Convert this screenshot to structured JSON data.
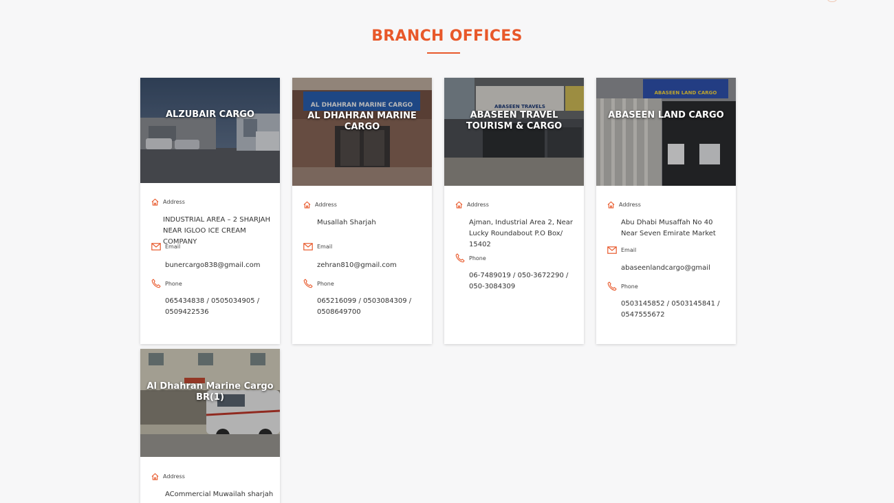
{
  "page": {
    "title": "BRANCH OFFICES",
    "accent": "#e8582a"
  },
  "labels": {
    "address": "Address",
    "email": "Email",
    "phone": "Phone"
  },
  "branches": [
    {
      "name": "ALZUBAIR CARGO",
      "address": "INDUSTRIAL AREA – 2 SHARJAH NEAR IGLOO ICE CREAM COMPANY",
      "email": "bunercargo838@gmail.com",
      "phone": "065434838 / 0505034905 / 0509422536"
    },
    {
      "name": "AL DHAHRAN MARINE CARGO",
      "sign_text": "AL DHAHRAN MARINE CARGO",
      "address": "Musallah Sharjah",
      "email": "zehran810@gmail.com",
      "phone": "065216099 / 0503084309 / 0508649700"
    },
    {
      "name": "ABASEEN TRAVEL TOURISM & CARGO",
      "sign_text": "ABASEEN TRAVELS",
      "address": "Ajman, Industrial Area 2, Near Lucky Roundabout P.O Box/ 15402",
      "phone": "06-7489019 / 050-3672290 / 050-3084309"
    },
    {
      "name": "ABASEEN LAND CARGO",
      "sign_text": "ABASEEN LAND CARGO",
      "address": "Abu Dhabi Musaffah No 40 Near Seven Emirate Market",
      "email": "abaseenlandcargo@gmail",
      "phone": "0503145852 / 0503145841 / 0547555672"
    },
    {
      "name": "Al Dhahran Marine Cargo BR(1)",
      "address": "ACommercial Muwailah sharjah"
    }
  ],
  "icons": {
    "address": "home-icon",
    "email": "mail-icon",
    "phone": "phone-icon"
  }
}
